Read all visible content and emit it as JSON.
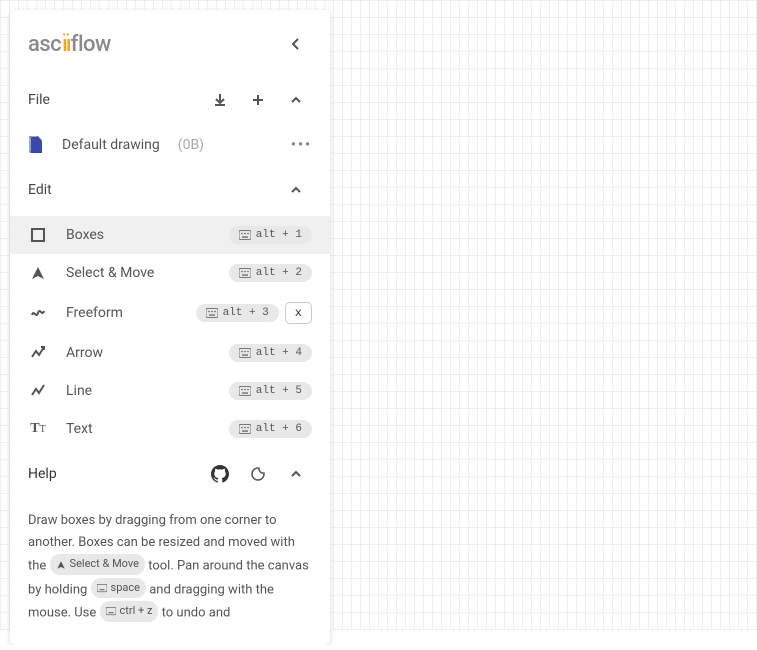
{
  "app": {
    "logo_left": "asc",
    "logo_right": "flow"
  },
  "sections": {
    "file": "File",
    "edit": "Edit",
    "help": "Help"
  },
  "file": {
    "name": "Default drawing",
    "size": "(0B)"
  },
  "tools": {
    "boxes": {
      "label": "Boxes",
      "shortcut": "alt + 1",
      "selected": true
    },
    "select": {
      "label": "Select & Move",
      "shortcut": "alt + 2"
    },
    "freeform": {
      "label": "Freeform",
      "shortcut": "alt + 3",
      "extra": "x"
    },
    "arrow": {
      "label": "Arrow",
      "shortcut": "alt + 4"
    },
    "line": {
      "label": "Line",
      "shortcut": "alt + 5"
    },
    "text": {
      "label": "Text",
      "shortcut": "alt + 6"
    }
  },
  "help_text": {
    "p1": "Draw boxes by dragging from one corner to another. Boxes can be resized and moved with the",
    "chip1": "Select & Move",
    "p2": "tool. Pan around the canvas by holding",
    "chip2": "space",
    "p3": "and dragging with the mouse. Use",
    "chip3": "ctrl + z",
    "p4": "to undo and"
  }
}
